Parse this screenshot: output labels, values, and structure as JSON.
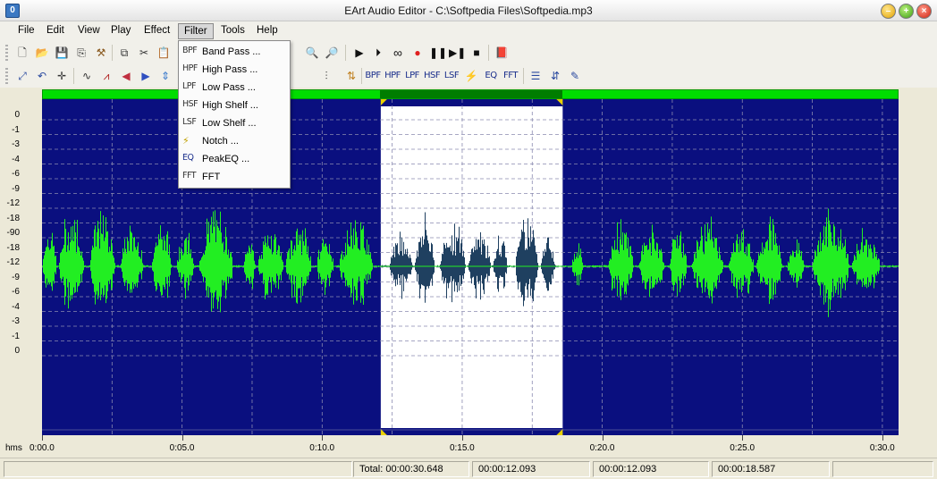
{
  "window": {
    "title": "EArt Audio Editor - C:\\Softpedia Files\\Softpedia.mp3",
    "app_icon": "0"
  },
  "menu": [
    {
      "label": "File"
    },
    {
      "label": "Edit"
    },
    {
      "label": "View"
    },
    {
      "label": "Play"
    },
    {
      "label": "Effect"
    },
    {
      "label": "Filter"
    },
    {
      "label": "Tools"
    },
    {
      "label": "Help"
    }
  ],
  "filter_menu": [
    {
      "icon": "BPF",
      "label": "Band Pass ..."
    },
    {
      "icon": "HPF",
      "label": "High Pass ..."
    },
    {
      "icon": "LPF",
      "label": "Low Pass ..."
    },
    {
      "icon": "HSF",
      "label": "High Shelf ..."
    },
    {
      "icon": "LSF",
      "label": "Low Shelf ..."
    },
    {
      "icon": "notch-icon",
      "label": "Notch ..."
    },
    {
      "icon": "EQ",
      "label": "PeakEQ ..."
    },
    {
      "icon": "FFT",
      "label": "FFT"
    }
  ],
  "toolbar2_text_tools": [
    "BPF",
    "HPF",
    "LPF",
    "HSF",
    "LSF",
    "EQ",
    "FFT"
  ],
  "db_scale": [
    "0",
    "-1",
    "-3",
    "-4",
    "-6",
    "-9",
    "-12",
    "-18",
    "-90",
    "-18",
    "-12",
    "-9",
    "-6",
    "-4",
    "-3",
    "-1",
    "0"
  ],
  "timeline": {
    "unit": "hms",
    "labels": [
      "0:00.0",
      "0:05.0",
      "0:10.0",
      "0:15.0",
      "0:20.0",
      "0:25.0",
      "0:30.0"
    ]
  },
  "selection": {
    "start_s": 12.093,
    "end_s": 18.587
  },
  "status": {
    "total": "Total: 00:00:30.648",
    "cursor": "00:00:12.093",
    "sel_start": "00:00:12.093",
    "sel_end": "00:00:18.587"
  },
  "colors": {
    "wave_bg": "#0a0f7f",
    "wave_fg": "#22ee22",
    "selection_bg": "#ffffff",
    "selection_wave": "#1f4060",
    "overview": "#00dd00"
  }
}
